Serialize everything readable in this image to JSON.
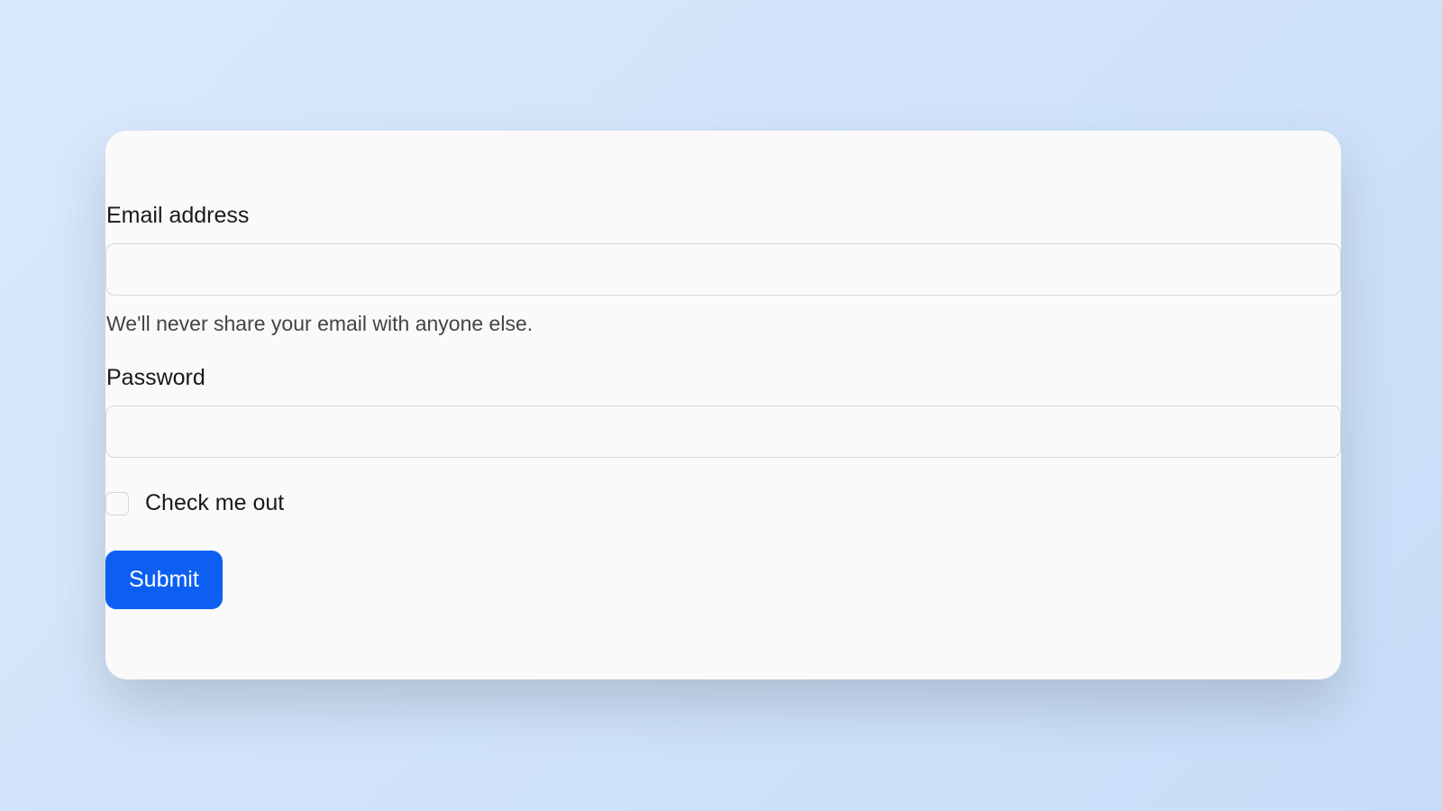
{
  "form": {
    "email": {
      "label": "Email address",
      "value": "",
      "helpText": "We'll never share your email with anyone else."
    },
    "password": {
      "label": "Password",
      "value": ""
    },
    "checkbox": {
      "label": "Check me out",
      "checked": false
    },
    "submit": {
      "label": "Submit"
    }
  },
  "colors": {
    "primary": "#0d5ff2",
    "text": "#1a1a1a",
    "muted": "#444444",
    "border": "#d6d6d6",
    "cardBg": "#fafafa"
  }
}
